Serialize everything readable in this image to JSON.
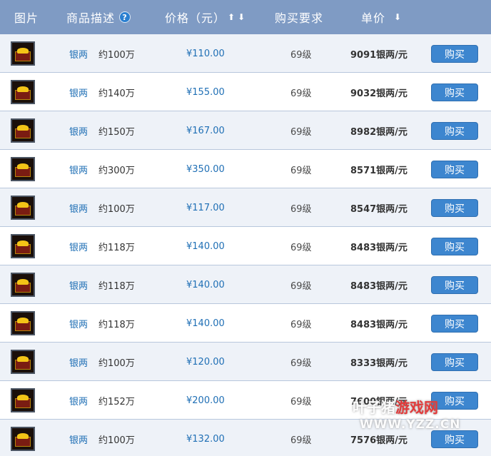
{
  "header": {
    "image": "图片",
    "description": "商品描述",
    "help_icon": "?",
    "price": "价格（元）",
    "sort_up": "⬆",
    "sort_down": "⬇",
    "requirement": "购买要求",
    "unit_price": "单价",
    "unit_sort": "⬇"
  },
  "items": [
    {
      "name": "银两",
      "amount": "约100万",
      "price": "¥110.00",
      "level": "69级",
      "unit": "9091银两/元",
      "button": "购买"
    },
    {
      "name": "银两",
      "amount": "约140万",
      "price": "¥155.00",
      "level": "69级",
      "unit": "9032银两/元",
      "button": "购买"
    },
    {
      "name": "银两",
      "amount": "约150万",
      "price": "¥167.00",
      "level": "69级",
      "unit": "8982银两/元",
      "button": "购买"
    },
    {
      "name": "银两",
      "amount": "约300万",
      "price": "¥350.00",
      "level": "69级",
      "unit": "8571银两/元",
      "button": "购买"
    },
    {
      "name": "银两",
      "amount": "约100万",
      "price": "¥117.00",
      "level": "69级",
      "unit": "8547银两/元",
      "button": "购买"
    },
    {
      "name": "银两",
      "amount": "约118万",
      "price": "¥140.00",
      "level": "69级",
      "unit": "8483银两/元",
      "button": "购买"
    },
    {
      "name": "银两",
      "amount": "约118万",
      "price": "¥140.00",
      "level": "69级",
      "unit": "8483银两/元",
      "button": "购买"
    },
    {
      "name": "银两",
      "amount": "约118万",
      "price": "¥140.00",
      "level": "69级",
      "unit": "8483银两/元",
      "button": "购买"
    },
    {
      "name": "银两",
      "amount": "约100万",
      "price": "¥120.00",
      "level": "69级",
      "unit": "8333银两/元",
      "button": "购买"
    },
    {
      "name": "银两",
      "amount": "约152万",
      "price": "¥200.00",
      "level": "69级",
      "unit": "7600银两/元",
      "button": "购买"
    },
    {
      "name": "银两",
      "amount": "约100万",
      "price": "¥132.00",
      "level": "69级",
      "unit": "7576银两/元",
      "button": "购买"
    }
  ],
  "watermark": {
    "brand_gray": "叶子猪",
    "brand_red": "游戏网",
    "url": "WWW.YZZ.CN"
  }
}
